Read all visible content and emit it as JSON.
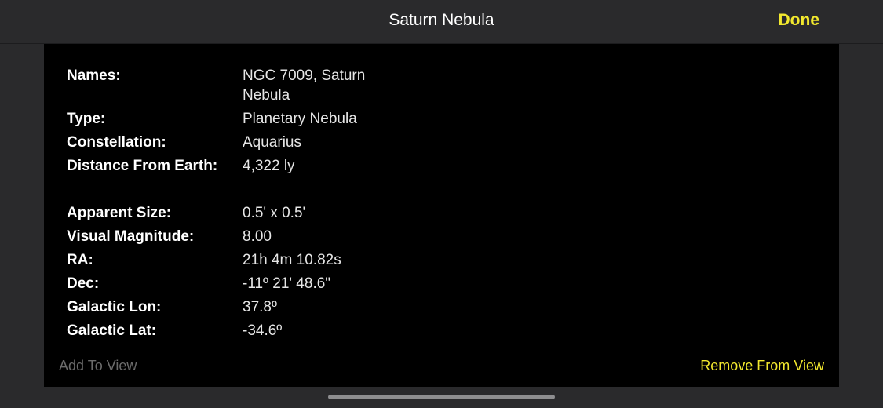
{
  "header": {
    "title": "Saturn Nebula",
    "done_label": "Done"
  },
  "info": {
    "group1": [
      {
        "label": "Names:",
        "value": "NGC 7009, Saturn Nebula"
      },
      {
        "label": "Type:",
        "value": "Planetary Nebula"
      },
      {
        "label": "Constellation:",
        "value": "Aquarius"
      },
      {
        "label": "Distance From Earth:",
        "value": "4,322 ly"
      }
    ],
    "group2": [
      {
        "label": "Apparent Size:",
        "value": "0.5' x 0.5'"
      },
      {
        "label": "Visual Magnitude:",
        "value": "8.00"
      },
      {
        "label": "RA:",
        "value": "21h 4m 10.82s"
      },
      {
        "label": "Dec:",
        "value": "-11º 21' 48.6\""
      },
      {
        "label": "Galactic Lon:",
        "value": "37.8º"
      },
      {
        "label": "Galactic Lat:",
        "value": "-34.6º"
      }
    ]
  },
  "actions": {
    "add_label": "Add To View",
    "remove_label": "Remove From View"
  },
  "colors": {
    "accent": "#f2e82e",
    "nav_background": "#2a2a2c",
    "panel_background": "#000000",
    "disabled_text": "#6b6b6b"
  }
}
